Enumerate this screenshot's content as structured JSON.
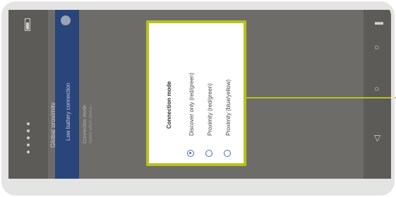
{
  "status_bar": {
    "title": "Global proximity",
    "icons": [
      "battery-icon",
      "signal-icon",
      "wifi-icon"
    ]
  },
  "app_bar": {
    "title": "Low battery connection",
    "icon": "settings-icon"
  },
  "list": {
    "item_title": "Connection mode",
    "item_subtitle": "Select which device..."
  },
  "dialog": {
    "title": "Connection mode",
    "options": [
      {
        "label": "Discover only (red/green)",
        "selected": true
      },
      {
        "label": "Proximity (red/green)",
        "selected": false
      },
      {
        "label": "Proximity (blue/yellow)",
        "selected": false
      }
    ]
  },
  "colors": {
    "highlight": "#b8c11c",
    "appbar": "#29457a",
    "radio": "#4a6bb0"
  }
}
